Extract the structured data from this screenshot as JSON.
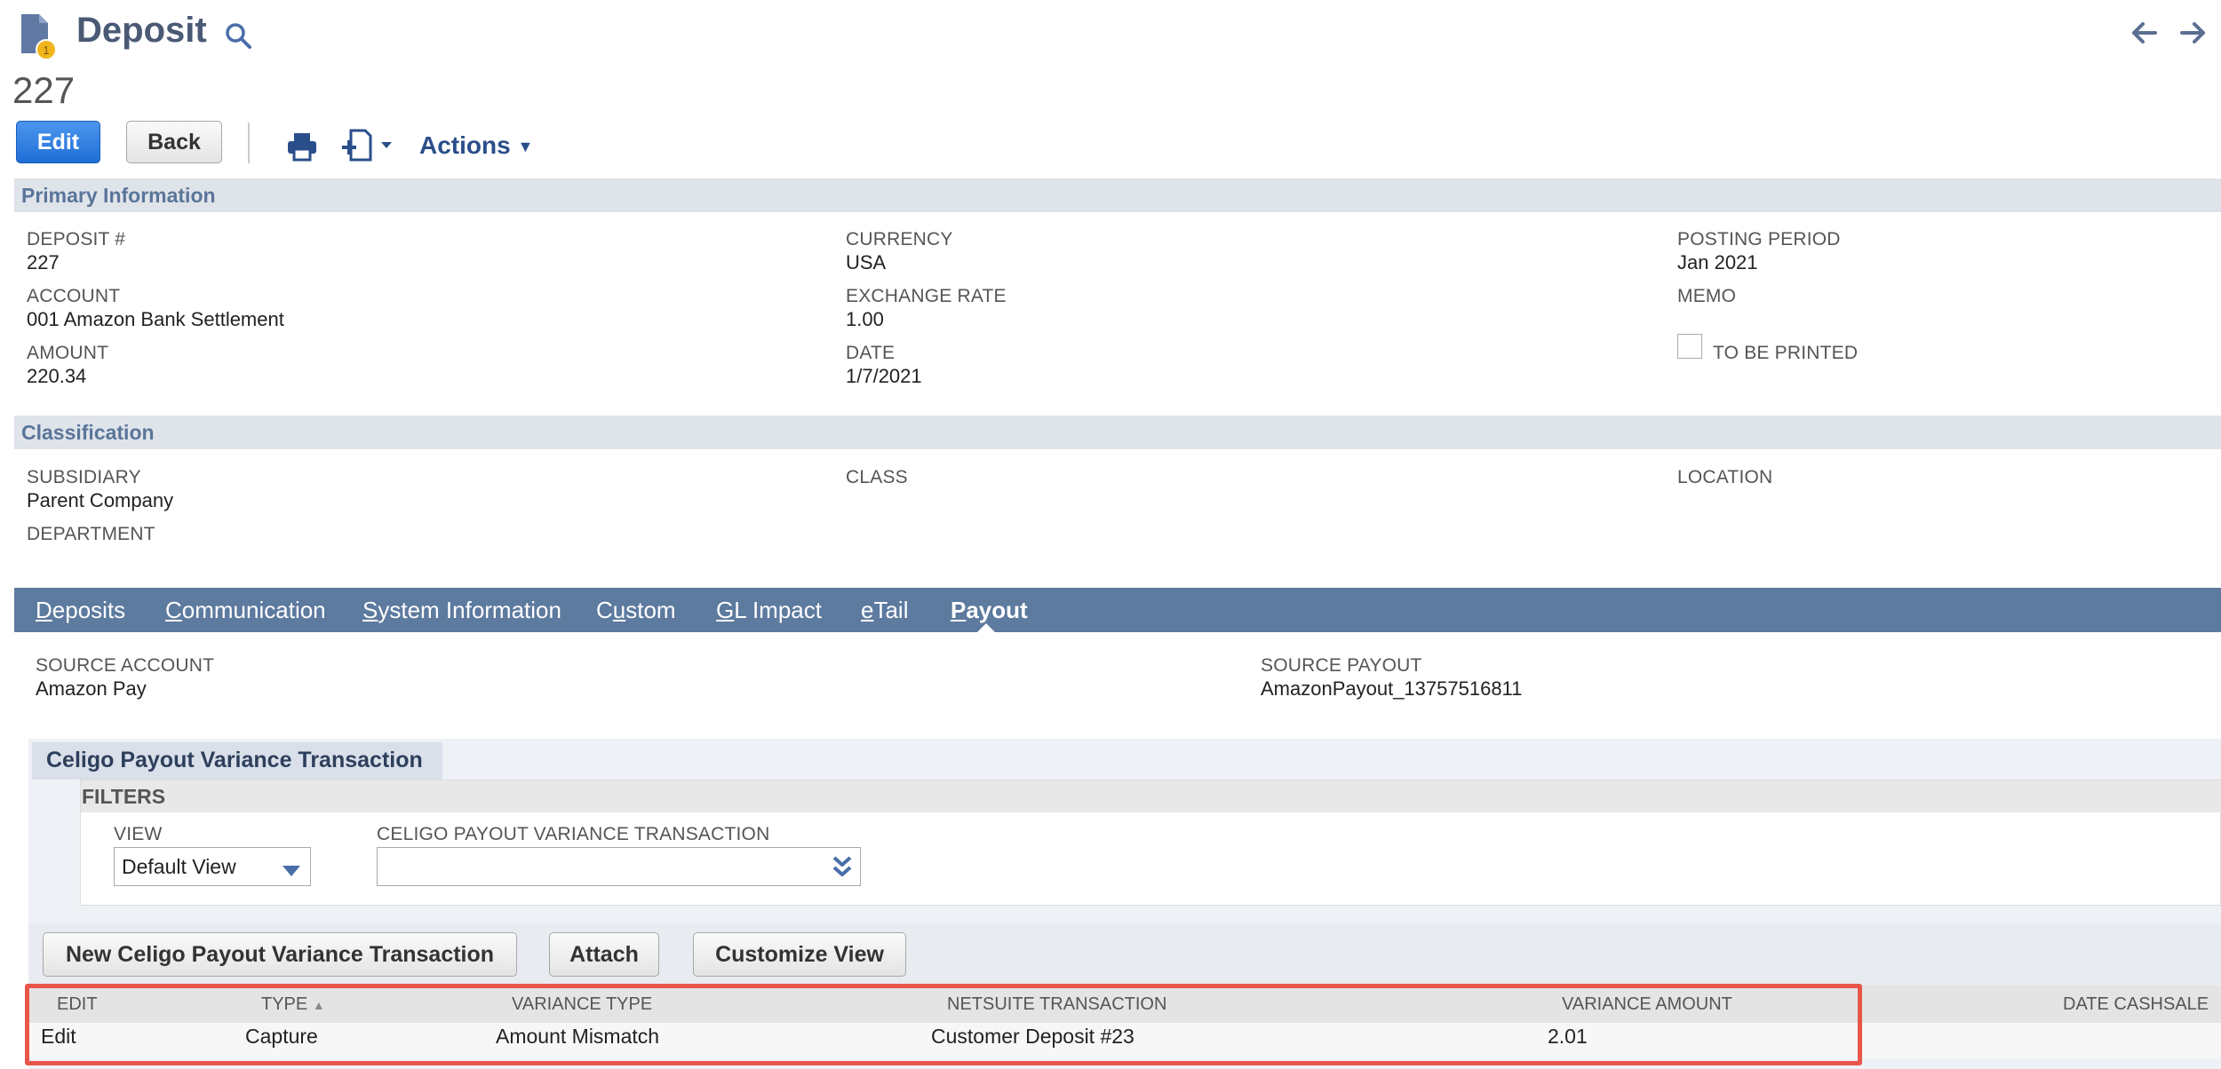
{
  "header": {
    "title": "Deposit",
    "record_number": "227"
  },
  "toolbar": {
    "edit_label": "Edit",
    "back_label": "Back",
    "actions_label": "Actions"
  },
  "primary": {
    "section_title": "Primary Information",
    "deposit_label": "DEPOSIT #",
    "deposit_value": "227",
    "account_label": "ACCOUNT",
    "account_value": "001 Amazon Bank Settlement",
    "amount_label": "AMOUNT",
    "amount_value": "220.34",
    "currency_label": "CURRENCY",
    "currency_value": "USA",
    "rate_label": "EXCHANGE RATE",
    "rate_value": "1.00",
    "date_label": "DATE",
    "date_value": "1/7/2021",
    "period_label": "POSTING PERIOD",
    "period_value": "Jan 2021",
    "memo_label": "MEMO",
    "print_label": "TO BE PRINTED",
    "to_be_printed": false
  },
  "classification": {
    "section_title": "Classification",
    "subsidiary_label": "SUBSIDIARY",
    "subsidiary_value": "Parent Company",
    "department_label": "DEPARTMENT",
    "class_label": "CLASS",
    "location_label": "LOCATION"
  },
  "tabs": {
    "deposits": "Deposits",
    "communication": "Communication",
    "system": "System Information",
    "custom": "Custom",
    "gl": "GL Impact",
    "etail": "eTail",
    "payout": "Payout",
    "active": "Payout"
  },
  "payout": {
    "source_account_label": "SOURCE ACCOUNT",
    "source_account_value": "Amazon Pay",
    "source_payout_label": "SOURCE PAYOUT",
    "source_payout_value": "AmazonPayout_13757516811"
  },
  "sublist": {
    "title": "Celigo Payout Variance Transaction",
    "filters_title": "FILTERS",
    "view_label": "VIEW",
    "view_value": "Default View",
    "txn_filter_label": "CELIGO PAYOUT VARIANCE TRANSACTION",
    "txn_filter_value": "",
    "btn_new": "New Celigo Payout Variance Transaction",
    "btn_attach": "Attach",
    "btn_customize": "Customize View",
    "columns": {
      "edit": "EDIT",
      "type": "TYPE",
      "variance_type": "VARIANCE TYPE",
      "netsuite_txn": "NETSUITE TRANSACTION",
      "variance_amount": "VARIANCE AMOUNT",
      "date_cashsale": "DATE CASHSALE"
    },
    "sorted_column": "TYPE",
    "sort_indicator": "▲",
    "rows": [
      {
        "edit": "Edit",
        "type": "Capture",
        "variance_type": "Amount Mismatch",
        "netsuite_txn": "Customer Deposit #23",
        "variance_amount": "2.01",
        "date_cashsale": ""
      }
    ]
  },
  "colors": {
    "accent": "#1f6ed6",
    "tab_bar": "#5d7a9f",
    "section_bar": "#dfe4eb",
    "highlight": "#e8564a"
  }
}
